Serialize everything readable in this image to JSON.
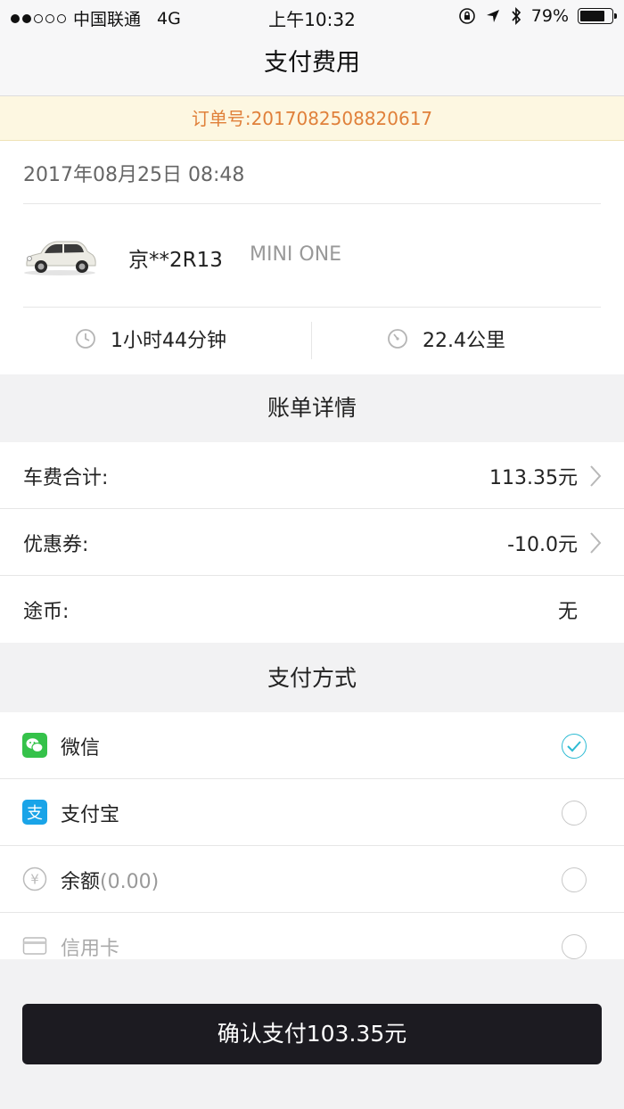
{
  "status_bar": {
    "carrier": "中国联通",
    "network": "4G",
    "time": "上午10:32",
    "battery": "79%",
    "battery_level": 0.79,
    "signal_bars_filled": 2,
    "signal_bars_total": 5
  },
  "nav": {
    "title": "支付费用"
  },
  "order": {
    "number_text": "订单号:2017082508820617"
  },
  "trip": {
    "datetime": "2017年08月25日 08:48",
    "plate": "京**2R13",
    "model": "MINI ONE",
    "duration": "1小时44分钟",
    "distance": "22.4公里"
  },
  "bill": {
    "section_title": "账单详情",
    "rows": [
      {
        "label": "车费合计:",
        "value": "113.35元"
      },
      {
        "label": "优惠券:",
        "value": "-10.0元"
      },
      {
        "label": "途币:",
        "value": "无"
      }
    ]
  },
  "payment": {
    "section_title": "支付方式",
    "methods": [
      {
        "label": "微信",
        "selected": true
      },
      {
        "label": "支付宝",
        "selected": false
      },
      {
        "label": "余额",
        "amount": "(0.00)",
        "selected": false
      },
      {
        "label": "信用卡",
        "selected": false
      }
    ]
  },
  "confirm_button": {
    "label": "确认支付103.35元"
  },
  "colors": {
    "accent_check": "#2dbbd3",
    "order_text": "#e0803a",
    "order_bg": "#fdf7e1",
    "button_bg": "#1c1b21",
    "wechat_green": "#35c24a",
    "alipay_blue": "#1aa4e8"
  }
}
